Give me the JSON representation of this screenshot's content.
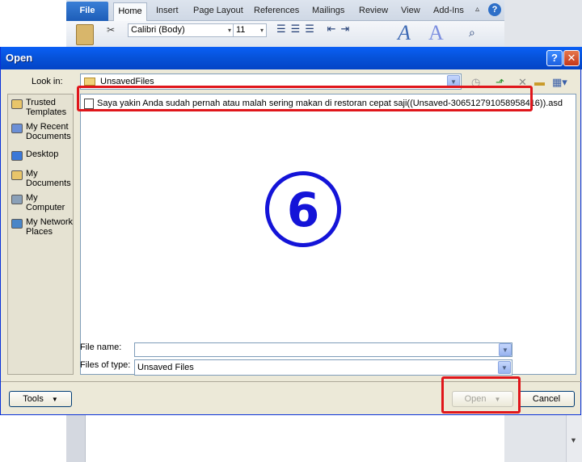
{
  "ribbon": {
    "tabs": [
      "File",
      "Home",
      "Insert",
      "Page Layout",
      "References",
      "Mailings",
      "Review",
      "View",
      "Add-Ins"
    ],
    "font": "Calibri (Body)",
    "size": "11"
  },
  "dialog": {
    "title": "Open",
    "help_glyph": "?",
    "close_glyph": "✕",
    "look_in_label": "Look in:",
    "look_in_value": "UnsavedFiles",
    "places": [
      {
        "label": "Trusted Templates",
        "icon": "trusted-templates-icon",
        "color": "#e8c56a"
      },
      {
        "label": "My Recent Documents",
        "icon": "recent-documents-icon",
        "color": "#6b8fd6"
      },
      {
        "label": "Desktop",
        "icon": "desktop-icon",
        "color": "#3b78d8"
      },
      {
        "label": "My Documents",
        "icon": "my-documents-icon",
        "color": "#e8c56a"
      },
      {
        "label": "My Computer",
        "icon": "my-computer-icon",
        "color": "#8aa0b8"
      },
      {
        "label": "My Network Places",
        "icon": "network-places-icon",
        "color": "#4a86c8"
      }
    ],
    "file": {
      "name": "Saya yakin Anda sudah pernah atau malah sering makan di restoran cepat saji((Unsaved-306512791058958416)).asd"
    },
    "step_number": "6",
    "file_name_label": "File name:",
    "file_name_value": "",
    "files_of_type_label": "Files of type:",
    "files_of_type_value": "Unsaved Files",
    "tools_label": "Tools",
    "open_label": "Open",
    "cancel_label": "Cancel"
  },
  "colors": {
    "titlebar": "#0652d8",
    "highlight": "#e0161b",
    "step": "#1414d8"
  }
}
